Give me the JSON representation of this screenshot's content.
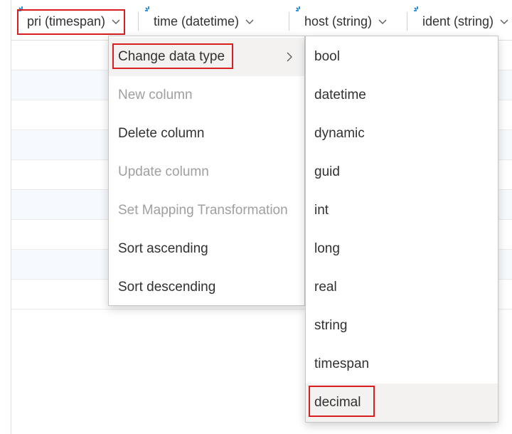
{
  "columns": [
    {
      "label": "pri (timespan)"
    },
    {
      "label": "time (datetime)"
    },
    {
      "label": "host (string)"
    },
    {
      "label": "ident (string)"
    }
  ],
  "context_menu": {
    "items": [
      {
        "label": "Change data type",
        "enabled": true,
        "has_submenu": true
      },
      {
        "label": "New column",
        "enabled": false
      },
      {
        "label": "Delete column",
        "enabled": true
      },
      {
        "label": "Update column",
        "enabled": false
      },
      {
        "label": "Set Mapping Transformation",
        "enabled": false
      },
      {
        "label": "Sort ascending",
        "enabled": true
      },
      {
        "label": "Sort descending",
        "enabled": true
      }
    ]
  },
  "data_type_submenu": {
    "items": [
      {
        "label": "bool"
      },
      {
        "label": "datetime"
      },
      {
        "label": "dynamic"
      },
      {
        "label": "guid"
      },
      {
        "label": "int"
      },
      {
        "label": "long"
      },
      {
        "label": "real"
      },
      {
        "label": "string"
      },
      {
        "label": "timespan"
      },
      {
        "label": "decimal"
      }
    ],
    "highlighted": "decimal"
  },
  "icons": {
    "column_header": "loading-spinner-icon",
    "dropdown": "chevron-down-icon",
    "submenu": "chevron-right-icon"
  },
  "colors": {
    "highlight_box": "#d81e1e",
    "accent": "#0078d4",
    "disabled_text": "#a19f9d"
  }
}
